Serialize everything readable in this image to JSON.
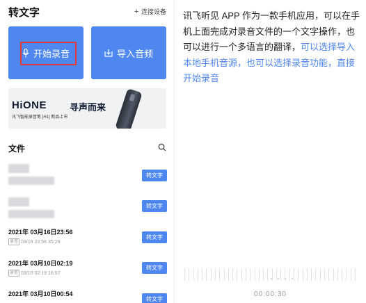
{
  "app": {
    "title": "转文字",
    "connect_label": "连接设备",
    "connect_plus": "+"
  },
  "cards": {
    "record_label": "开始录音",
    "import_label": "导入音频"
  },
  "banner": {
    "brand": "HiONE",
    "slogan": "寻声而来",
    "sub": "讯飞智能录音笔 [H1] 新品上市"
  },
  "files": {
    "title": "文件",
    "button_label": "转文字",
    "items": [
      {
        "title": "",
        "tag": "",
        "meta": "",
        "blurred": true
      },
      {
        "title": "",
        "tag": "",
        "meta": "",
        "blurred": true
      },
      {
        "title": "2021年 03月16日23:56",
        "tag": "录音",
        "meta": "03/16 23:56  35:26"
      },
      {
        "title": "2021年 03月10日02:19",
        "tag": "录音",
        "meta": "03/10 02:19  16:57"
      },
      {
        "title": "2021年 03月10日00:54",
        "tag": "",
        "meta": ""
      }
    ]
  },
  "description": {
    "normal": "讯飞听见 APP 作为一款手机应用，可以在手机上面完成对录音文件的一个文字操作，也可以进行一个多语言的翻译，",
    "highlight": "可以选择导入本地手机音源，也可以选择录音功能，直接开始录音"
  },
  "recorder": {
    "timer": "00:00:30"
  },
  "colors": {
    "accent": "#4f87f0",
    "highlight_border": "#e53935"
  }
}
